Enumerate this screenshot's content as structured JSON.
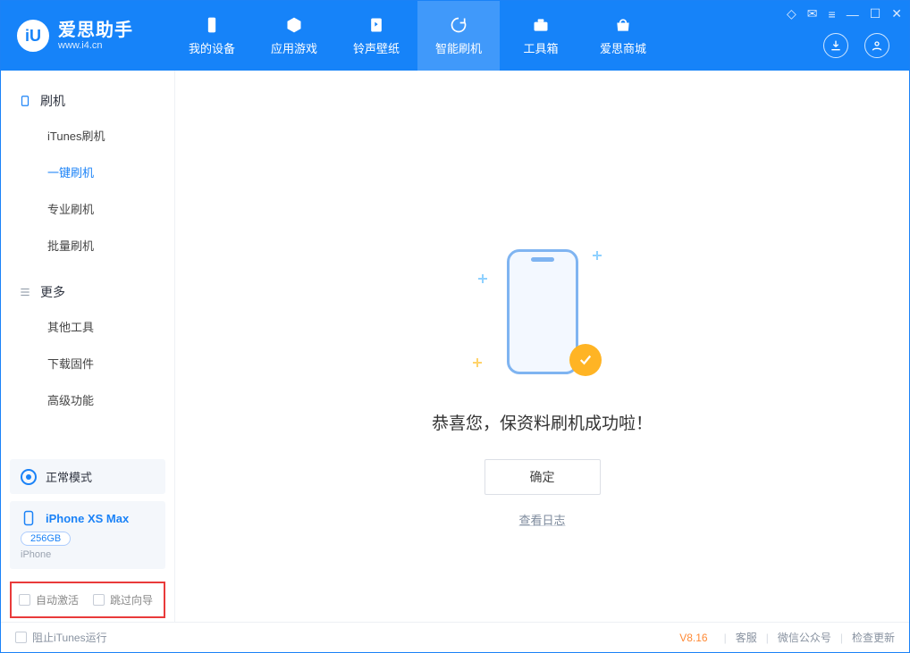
{
  "brand": {
    "title": "爱思助手",
    "sub": "www.i4.cn",
    "logo_letter": "iU"
  },
  "tabs": [
    {
      "label": "我的设备",
      "icon": "phone"
    },
    {
      "label": "应用游戏",
      "icon": "cube"
    },
    {
      "label": "铃声壁纸",
      "icon": "note"
    },
    {
      "label": "智能刷机",
      "icon": "refresh",
      "active": true
    },
    {
      "label": "工具箱",
      "icon": "toolbox"
    },
    {
      "label": "爱思商城",
      "icon": "store"
    }
  ],
  "sidebar": {
    "section1": {
      "title": "刷机",
      "items": [
        "iTunes刷机",
        "一键刷机",
        "专业刷机",
        "批量刷机"
      ],
      "active_index": 1
    },
    "section2": {
      "title": "更多",
      "items": [
        "其他工具",
        "下载固件",
        "高级功能"
      ]
    }
  },
  "mode_panel": {
    "label": "正常模式"
  },
  "device_panel": {
    "name": "iPhone XS Max",
    "storage": "256GB",
    "type": "iPhone"
  },
  "options": {
    "auto_activate": "自动激活",
    "skip_wizard": "跳过向导"
  },
  "main": {
    "success": "恭喜您，保资料刷机成功啦！",
    "confirm": "确定",
    "view_log": "查看日志"
  },
  "footer": {
    "block_itunes": "阻止iTunes运行",
    "version": "V8.16",
    "support": "客服",
    "wechat": "微信公众号",
    "update": "检查更新"
  }
}
